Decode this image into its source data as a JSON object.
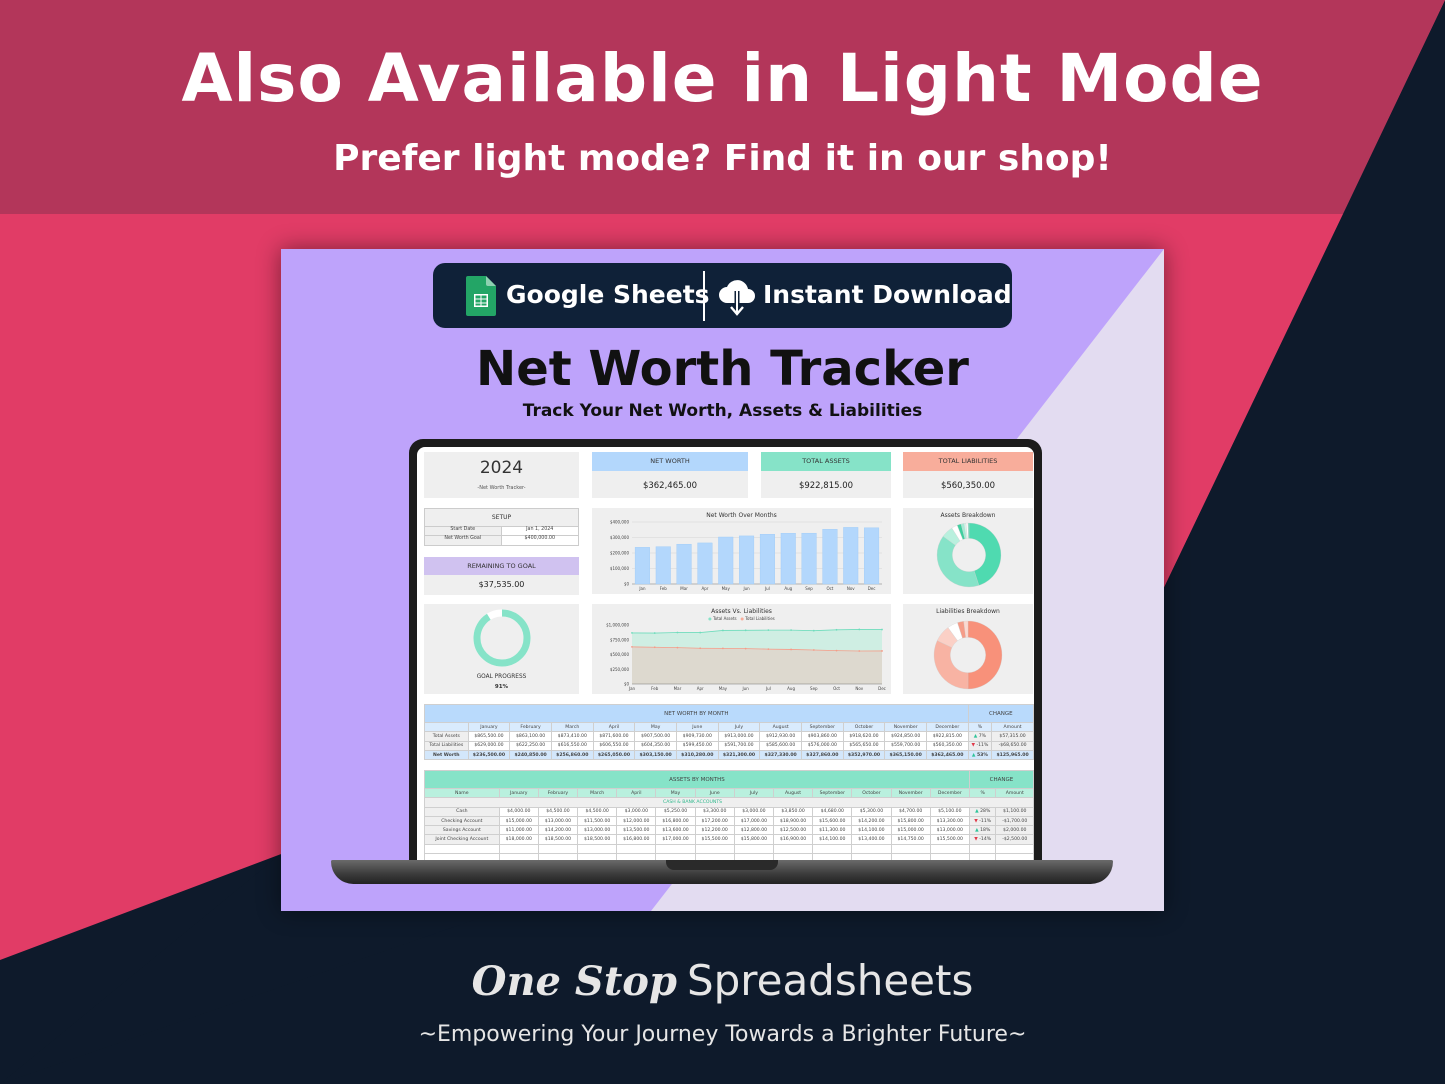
{
  "banner": {
    "headline": "Also Available in Light Mode",
    "subheadline": "Prefer light mode? Find it in our shop!"
  },
  "colors": {
    "banner_top": "#b3365a",
    "banner_pink": "#e13c66",
    "navy": "#0e1a2b",
    "card_purple": "#bea3fb",
    "card_lavender": "#e3dcf1",
    "net_worth_blue": "#b3d7fc",
    "assets_green": "#86e3c8",
    "liabilities_salmon": "#f8ad9b",
    "goal_purple": "#d0c2f0"
  },
  "badge": {
    "sheets_label": "Google Sheets",
    "download_label": "Instant Download",
    "sheets_icon": "google-sheets-icon",
    "download_icon": "cloud-download-icon"
  },
  "product": {
    "title": "Net Worth Tracker",
    "subtitle": "Track Your Net Worth, Assets & Liabilities"
  },
  "dashboard": {
    "year": "2024",
    "year_caption": "-Net Worth Tracker-",
    "kpis": [
      {
        "label": "NET WORTH",
        "value": "$362,465.00"
      },
      {
        "label": "TOTAL ASSETS",
        "value": "$922,815.00"
      },
      {
        "label": "TOTAL LIABILITIES",
        "value": "$560,350.00"
      }
    ],
    "setup": {
      "title": "SETUP",
      "rows": [
        {
          "label": "Start Date",
          "value": "Jan 1, 2024"
        },
        {
          "label": "Net Worth Goal",
          "value": "$400,000.00"
        }
      ]
    },
    "remaining": {
      "label": "REMAINING TO GOAL",
      "value": "$37,535.00"
    },
    "goal_progress": {
      "label": "GOAL PROGRESS",
      "value_text": "91%",
      "fraction": 0.91
    }
  },
  "chart_data": [
    {
      "type": "bar",
      "title": "Net Worth Over Months",
      "categories": [
        "Jan",
        "Feb",
        "Mar",
        "Apr",
        "May",
        "Jun",
        "Jul",
        "Aug",
        "Sep",
        "Oct",
        "Nov",
        "Dec"
      ],
      "values": [
        236500,
        240850,
        256860,
        265050,
        303150,
        310280,
        321300,
        327330,
        327860,
        352970,
        365150,
        362465
      ],
      "yticks": [
        "$0",
        "$100,000",
        "$200,000",
        "$300,000",
        "$400,000"
      ],
      "ylim": [
        0,
        400000
      ],
      "grid": true,
      "color": "#b3d7fc"
    },
    {
      "type": "area",
      "title": "Assets Vs. Liabilities",
      "categories": [
        "Jan",
        "Feb",
        "Mar",
        "Apr",
        "May",
        "Jun",
        "Jul",
        "Aug",
        "Sep",
        "Oct",
        "Nov",
        "Dec"
      ],
      "series": [
        {
          "name": "Total Assets",
          "color": "#86e3c8",
          "values": [
            865500,
            863100,
            873410,
            871600,
            907500,
            909730,
            913000,
            912930,
            903860,
            918620,
            924850,
            922815
          ]
        },
        {
          "name": "Total Liabilities",
          "color": "#f8ad9b",
          "values": [
            629000,
            622250,
            616550,
            606550,
            604350,
            599450,
            591700,
            585600,
            576000,
            565650,
            559700,
            560350
          ]
        }
      ],
      "yticks": [
        "$0",
        "$250,000",
        "$500,000",
        "$750,000",
        "$1,000,000"
      ],
      "ylim": [
        0,
        1000000
      ],
      "legend": "top"
    },
    {
      "type": "pie",
      "title": "Assets Breakdown",
      "values": [
        45,
        40,
        6,
        3,
        2,
        1.5,
        1,
        1,
        0.5
      ],
      "colors": [
        "#4fdab0",
        "#86e3c8",
        "#b9f0de",
        "#ffffff",
        "#3fcf9f",
        "#a6ecd6",
        "#d6f6ec",
        "#ffffff",
        "#6fdcbc"
      ]
    },
    {
      "type": "pie",
      "title": "Liabilities Breakdown",
      "values": [
        50,
        32,
        8,
        5,
        3,
        2
      ],
      "colors": [
        "#f8917a",
        "#f8b3a3",
        "#fbd0c6",
        "#ffffff",
        "#f59c88",
        "#fcd9d0"
      ]
    }
  ],
  "net_worth_table": {
    "title": "NET WORTH BY MONTH",
    "change_title": "CHANGE",
    "columns": [
      "",
      "January",
      "February",
      "March",
      "April",
      "May",
      "June",
      "July",
      "August",
      "September",
      "October",
      "November",
      "December",
      "%",
      "Amount"
    ],
    "rows": [
      {
        "label": "Total Assets",
        "cells": [
          "$865,500.00",
          "$863,100.00",
          "$873,410.00",
          "$871,600.00",
          "$907,500.00",
          "$909,730.00",
          "$913,000.00",
          "$912,930.00",
          "$903,860.00",
          "$918,620.00",
          "$924,850.00",
          "$922,815.00"
        ],
        "dir": "up",
        "pct": "7%",
        "amount": "$57,315.00"
      },
      {
        "label": "Total Liabilities",
        "cells": [
          "$629,000.00",
          "$622,250.00",
          "$616,550.00",
          "$606,550.00",
          "$604,350.00",
          "$599,450.00",
          "$591,700.00",
          "$585,600.00",
          "$576,000.00",
          "$565,650.00",
          "$559,700.00",
          "$560,350.00"
        ],
        "dir": "down",
        "pct": "-11%",
        "amount": "-$68,650.00"
      },
      {
        "label": "Net Worth",
        "cells": [
          "$236,500.00",
          "$240,850.00",
          "$256,860.00",
          "$265,050.00",
          "$303,150.00",
          "$310,280.00",
          "$321,300.00",
          "$327,330.00",
          "$327,860.00",
          "$352,970.00",
          "$365,150.00",
          "$362,465.00"
        ],
        "dir": "up",
        "pct": "53%",
        "amount": "$125,965.00"
      }
    ]
  },
  "assets_table": {
    "title": "ASSETS BY MONTHS",
    "change_title": "CHANGE",
    "columns": [
      "Name",
      "January",
      "February",
      "March",
      "April",
      "May",
      "June",
      "July",
      "August",
      "September",
      "October",
      "November",
      "December",
      "%",
      "Amount"
    ],
    "section": "CASH & BANK ACCOUNTS",
    "rows": [
      {
        "label": "Cash",
        "cells": [
          "$4,000.00",
          "$4,500.00",
          "$4,500.00",
          "$3,000.00",
          "$5,250.00",
          "$3,300.00",
          "$3,000.00",
          "$3,850.00",
          "$4,680.00",
          "$5,300.00",
          "$4,700.00",
          "$5,100.00"
        ],
        "dir": "up",
        "pct": "28%",
        "amount": "$1,100.00"
      },
      {
        "label": "Checking Account",
        "cells": [
          "$15,000.00",
          "$13,000.00",
          "$11,500.00",
          "$12,000.00",
          "$16,800.00",
          "$17,200.00",
          "$17,000.00",
          "$18,900.00",
          "$15,600.00",
          "$14,200.00",
          "$15,800.00",
          "$13,300.00"
        ],
        "dir": "down",
        "pct": "-11%",
        "amount": "-$1,700.00"
      },
      {
        "label": "Savings Account",
        "cells": [
          "$11,000.00",
          "$14,200.00",
          "$13,000.00",
          "$13,500.00",
          "$13,600.00",
          "$12,200.00",
          "$12,800.00",
          "$12,500.00",
          "$11,300.00",
          "$14,100.00",
          "$15,000.00",
          "$13,000.00"
        ],
        "dir": "up",
        "pct": "18%",
        "amount": "$2,000.00"
      },
      {
        "label": "Joint Checking Account",
        "cells": [
          "$18,000.00",
          "$18,500.00",
          "$18,500.00",
          "$16,800.00",
          "$17,000.00",
          "$15,500.00",
          "$15,800.00",
          "$16,900.00",
          "$14,100.00",
          "$13,400.00",
          "$14,750.00",
          "$15,500.00"
        ],
        "dir": "down",
        "pct": "-14%",
        "amount": "-$2,500.00"
      }
    ]
  },
  "footer": {
    "brand_script": "One Stop",
    "brand_plain": "Spreadsheets",
    "tagline": "~Empowering Your Journey Towards a Brighter Future~"
  }
}
